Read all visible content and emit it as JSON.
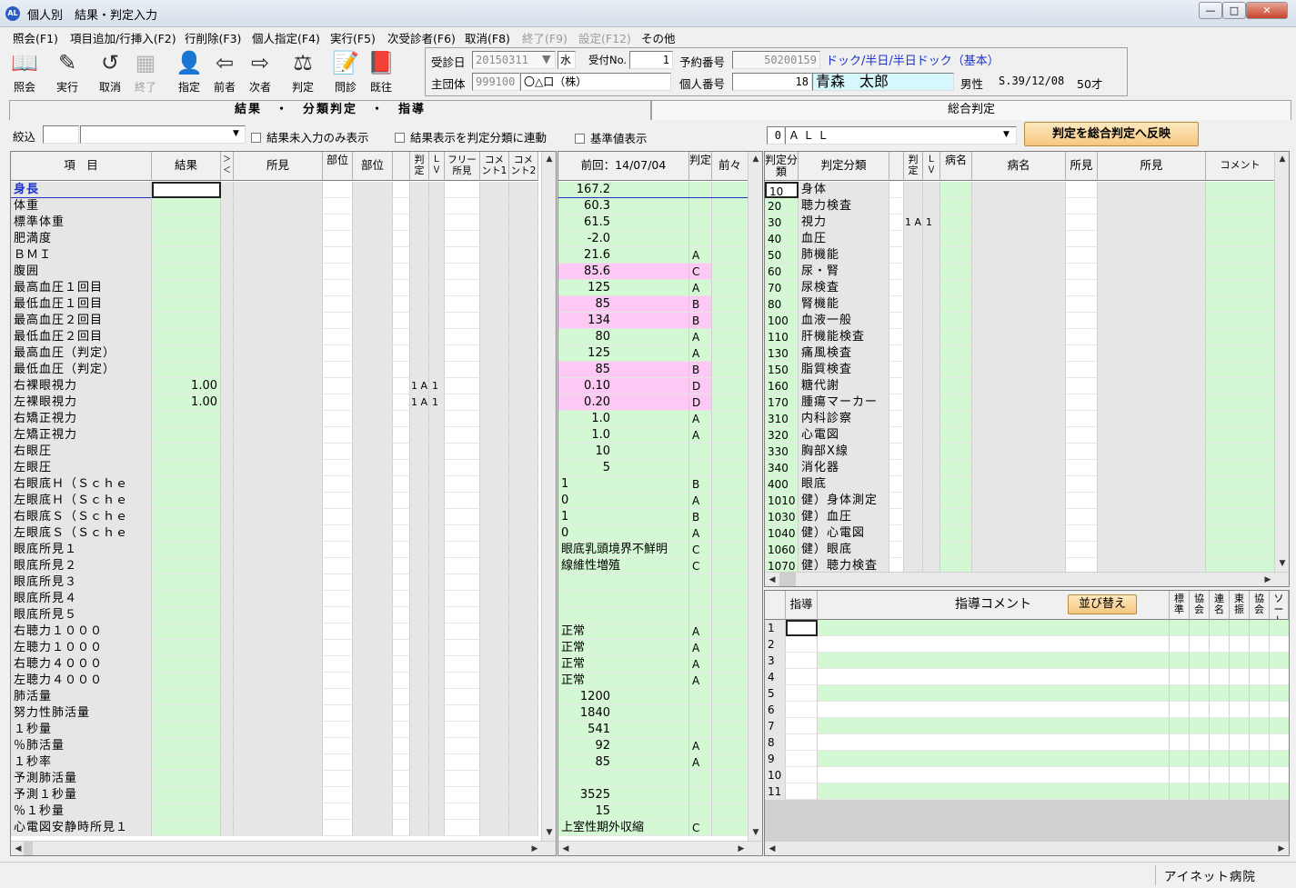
{
  "window": {
    "title": "個人別　結果・判定入力",
    "icon": "AL",
    "min": "—",
    "max": "□",
    "close": "✕"
  },
  "menu": [
    "照会(F1)",
    "項目追加/行挿入(F2)",
    "行削除(F3)",
    "個人指定(F4)",
    "実行(F5)",
    "次受診者(F6)",
    "取消(F8)",
    "終了(F9)",
    "設定(F12)",
    "その他"
  ],
  "toolbar": {
    "inquiry": "照会",
    "execute": "実行",
    "cancel": "取消",
    "end": "終了",
    "designate": "指定",
    "prev": "前者",
    "next": "次者",
    "judge": "判定",
    "interview": "問診",
    "history": "既往"
  },
  "info": {
    "exam_date_label": "受診日",
    "exam_date": "20150311",
    "weekday": "水",
    "reception_no_label": "受付No.",
    "reception_no": "1",
    "reservation_label": "予約番号",
    "reservation_no": "50200159",
    "course": "ドック/半日/半日ドック（基本）",
    "group_label": "主団体",
    "group_code": "999100",
    "group_name": "〇△口（株）",
    "personal_label": "個人番号",
    "personal_no": "18",
    "patient_name": "青森　太郎",
    "gender": "男性",
    "birth": "S.39/12/08",
    "age": "50才"
  },
  "tabs": {
    "left": "結果　・　分類判定　・　指導",
    "right": "総合判定"
  },
  "filter": {
    "label": "絞込",
    "opt1": "結果未入力のみ表示",
    "opt2": "結果表示を判定分類に連動",
    "opt3": "基準値表示"
  },
  "right_filter": {
    "code": "0",
    "value": "ＡＬＬ",
    "button": "判定を総合判定へ反映"
  },
  "left_grid": {
    "headers": {
      "item": "項　目",
      "result": "結果",
      "cmp": "＞＜",
      "finding": "所見",
      "part": "部位",
      "part2": "部位",
      "judge": "判定",
      "lv": "ＬＶ",
      "free": "フリー所見",
      "cmt1": "コメント1",
      "cmt2": "コメント2",
      "prev": "前回：14/07/04",
      "pjudge": "判定",
      "prev2": "前々"
    },
    "rows": [
      {
        "n": "身長",
        "r": "",
        "j": "",
        "l": "",
        "p": "167.2",
        "pj": "",
        "pk": false
      },
      {
        "n": "体重",
        "r": "",
        "j": "",
        "l": "",
        "p": "60.3",
        "pj": "",
        "pk": false
      },
      {
        "n": "標準体重",
        "r": "",
        "j": "",
        "l": "",
        "p": "61.5",
        "pj": "",
        "pk": false
      },
      {
        "n": "肥満度",
        "r": "",
        "j": "",
        "l": "",
        "p": "-2.0",
        "pj": "",
        "pk": false
      },
      {
        "n": "ＢＭＩ",
        "r": "",
        "j": "",
        "l": "",
        "p": "21.6",
        "pj": "A",
        "pk": false
      },
      {
        "n": "腹囲",
        "r": "",
        "j": "",
        "l": "",
        "p": "85.6",
        "pj": "C",
        "pk": true
      },
      {
        "n": "最高血圧１回目",
        "r": "",
        "j": "",
        "l": "",
        "p": "125",
        "pj": "A",
        "pk": false
      },
      {
        "n": "最低血圧１回目",
        "r": "",
        "j": "",
        "l": "",
        "p": "85",
        "pj": "B",
        "pk": true
      },
      {
        "n": "最高血圧２回目",
        "r": "",
        "j": "",
        "l": "",
        "p": "134",
        "pj": "B",
        "pk": true
      },
      {
        "n": "最低血圧２回目",
        "r": "",
        "j": "",
        "l": "",
        "p": "80",
        "pj": "A",
        "pk": false
      },
      {
        "n": "最高血圧（判定）",
        "r": "",
        "j": "",
        "l": "",
        "p": "125",
        "pj": "A",
        "pk": false
      },
      {
        "n": "最低血圧（判定）",
        "r": "",
        "j": "",
        "l": "",
        "p": "85",
        "pj": "B",
        "pk": true
      },
      {
        "n": "右裸眼視力",
        "r": "1.00",
        "j": "1 A",
        "l": "1",
        "p": "0.10",
        "pj": "D",
        "pk": true
      },
      {
        "n": "左裸眼視力",
        "r": "1.00",
        "j": "1 A",
        "l": "1",
        "p": "0.20",
        "pj": "D",
        "pk": true
      },
      {
        "n": "右矯正視力",
        "r": "",
        "j": "",
        "l": "",
        "p": "1.0",
        "pj": "A",
        "pk": false
      },
      {
        "n": "左矯正視力",
        "r": "",
        "j": "",
        "l": "",
        "p": "1.0",
        "pj": "A",
        "pk": false
      },
      {
        "n": "右眼圧",
        "r": "",
        "j": "",
        "l": "",
        "p": "10",
        "pj": "",
        "pk": false
      },
      {
        "n": "左眼圧",
        "r": "",
        "j": "",
        "l": "",
        "p": "5",
        "pj": "",
        "pk": false
      },
      {
        "n": "右眼底Ｈ（Ｓｃｈｅ",
        "r": "",
        "j": "",
        "l": "",
        "p": "1",
        "pj": "B",
        "pk": false,
        "pl": true
      },
      {
        "n": "左眼底Ｈ（Ｓｃｈｅ",
        "r": "",
        "j": "",
        "l": "",
        "p": "0",
        "pj": "A",
        "pk": false,
        "pl": true
      },
      {
        "n": "右眼底Ｓ（Ｓｃｈｅ",
        "r": "",
        "j": "",
        "l": "",
        "p": "1",
        "pj": "B",
        "pk": false,
        "pl": true
      },
      {
        "n": "左眼底Ｓ（Ｓｃｈｅ",
        "r": "",
        "j": "",
        "l": "",
        "p": "0",
        "pj": "A",
        "pk": false,
        "pl": true
      },
      {
        "n": "眼底所見１",
        "r": "",
        "j": "",
        "l": "",
        "p": "眼底乳頭境界不鮮明",
        "pj": "C",
        "pk": false,
        "pl": true
      },
      {
        "n": "眼底所見２",
        "r": "",
        "j": "",
        "l": "",
        "p": "線維性増殖",
        "pj": "C",
        "pk": false,
        "pl": true
      },
      {
        "n": "眼底所見３",
        "r": "",
        "j": "",
        "l": "",
        "p": "",
        "pj": "",
        "pk": false
      },
      {
        "n": "眼底所見４",
        "r": "",
        "j": "",
        "l": "",
        "p": "",
        "pj": "",
        "pk": false
      },
      {
        "n": "眼底所見５",
        "r": "",
        "j": "",
        "l": "",
        "p": "",
        "pj": "",
        "pk": false
      },
      {
        "n": "右聴力１０００",
        "r": "",
        "j": "",
        "l": "",
        "p": "正常",
        "pj": "A",
        "pk": false,
        "pl": true
      },
      {
        "n": "左聴力１０００",
        "r": "",
        "j": "",
        "l": "",
        "p": "正常",
        "pj": "A",
        "pk": false,
        "pl": true
      },
      {
        "n": "右聴力４０００",
        "r": "",
        "j": "",
        "l": "",
        "p": "正常",
        "pj": "A",
        "pk": false,
        "pl": true
      },
      {
        "n": "左聴力４０００",
        "r": "",
        "j": "",
        "l": "",
        "p": "正常",
        "pj": "A",
        "pk": false,
        "pl": true
      },
      {
        "n": "肺活量",
        "r": "",
        "j": "",
        "l": "",
        "p": "1200",
        "pj": "",
        "pk": false
      },
      {
        "n": "努力性肺活量",
        "r": "",
        "j": "",
        "l": "",
        "p": "1840",
        "pj": "",
        "pk": false
      },
      {
        "n": "１秒量",
        "r": "",
        "j": "",
        "l": "",
        "p": "541",
        "pj": "",
        "pk": false
      },
      {
        "n": "％肺活量",
        "r": "",
        "j": "",
        "l": "",
        "p": "92",
        "pj": "A",
        "pk": false
      },
      {
        "n": "１秒率",
        "r": "",
        "j": "",
        "l": "",
        "p": "85",
        "pj": "A",
        "pk": false
      },
      {
        "n": "予測肺活量",
        "r": "",
        "j": "",
        "l": "",
        "p": "",
        "pj": "",
        "pk": false
      },
      {
        "n": "予測１秒量",
        "r": "",
        "j": "",
        "l": "",
        "p": "3525",
        "pj": "",
        "pk": false
      },
      {
        "n": "％１秒量",
        "r": "",
        "j": "",
        "l": "",
        "p": "15",
        "pj": "",
        "pk": false
      },
      {
        "n": "心電図安静時所見１",
        "r": "",
        "j": "",
        "l": "",
        "p": "上室性期外収縮",
        "pj": "C",
        "pk": false,
        "pl": true
      }
    ]
  },
  "judge_grid": {
    "headers": {
      "code": "判定分類",
      "name": "判定分類",
      "judge": "判定",
      "lv": "ＬＶ",
      "disease": "病名",
      "disease2": "病名",
      "finding": "所見",
      "finding2": "所見",
      "comment": "コメント"
    },
    "rows": [
      {
        "c": "10",
        "n": "身体",
        "j": "",
        "l": ""
      },
      {
        "c": "20",
        "n": "聴力検査",
        "j": "",
        "l": ""
      },
      {
        "c": "30",
        "n": "視力",
        "j": "1 A",
        "l": "1"
      },
      {
        "c": "40",
        "n": "血圧",
        "j": "",
        "l": ""
      },
      {
        "c": "50",
        "n": "肺機能",
        "j": "",
        "l": ""
      },
      {
        "c": "60",
        "n": "尿・腎",
        "j": "",
        "l": ""
      },
      {
        "c": "70",
        "n": "尿検査",
        "j": "",
        "l": ""
      },
      {
        "c": "80",
        "n": "腎機能",
        "j": "",
        "l": ""
      },
      {
        "c": "100",
        "n": "血液一般",
        "j": "",
        "l": ""
      },
      {
        "c": "110",
        "n": "肝機能検査",
        "j": "",
        "l": ""
      },
      {
        "c": "130",
        "n": "痛風検査",
        "j": "",
        "l": ""
      },
      {
        "c": "150",
        "n": "脂質検査",
        "j": "",
        "l": ""
      },
      {
        "c": "160",
        "n": "糖代謝",
        "j": "",
        "l": ""
      },
      {
        "c": "170",
        "n": "腫瘍マーカー",
        "j": "",
        "l": ""
      },
      {
        "c": "310",
        "n": "内科診察",
        "j": "",
        "l": ""
      },
      {
        "c": "320",
        "n": "心電図",
        "j": "",
        "l": ""
      },
      {
        "c": "330",
        "n": "胸部X線",
        "j": "",
        "l": ""
      },
      {
        "c": "340",
        "n": "消化器",
        "j": "",
        "l": ""
      },
      {
        "c": "400",
        "n": "眼底",
        "j": "",
        "l": ""
      },
      {
        "c": "1010",
        "n": "健）身体測定",
        "j": "",
        "l": ""
      },
      {
        "c": "1030",
        "n": "健）血圧",
        "j": "",
        "l": ""
      },
      {
        "c": "1040",
        "n": "健）心電図",
        "j": "",
        "l": ""
      },
      {
        "c": "1060",
        "n": "健）眼底",
        "j": "",
        "l": ""
      },
      {
        "c": "1070",
        "n": "健）聴力検査",
        "j": "",
        "l": ""
      }
    ]
  },
  "guide_grid": {
    "headers": {
      "guide": "指導",
      "comment": "指導コメント",
      "sort_button": "並び替え",
      "std": "標準",
      "assoc": "協会",
      "link": "連名",
      "shinko": "東振",
      "assoc2": "協会",
      "sort": "ソート"
    },
    "rows": [
      "1",
      "2",
      "3",
      "4",
      "5",
      "6",
      "7",
      "8",
      "9",
      "10",
      "11"
    ]
  },
  "status": {
    "hospital": "アイネット病院"
  }
}
